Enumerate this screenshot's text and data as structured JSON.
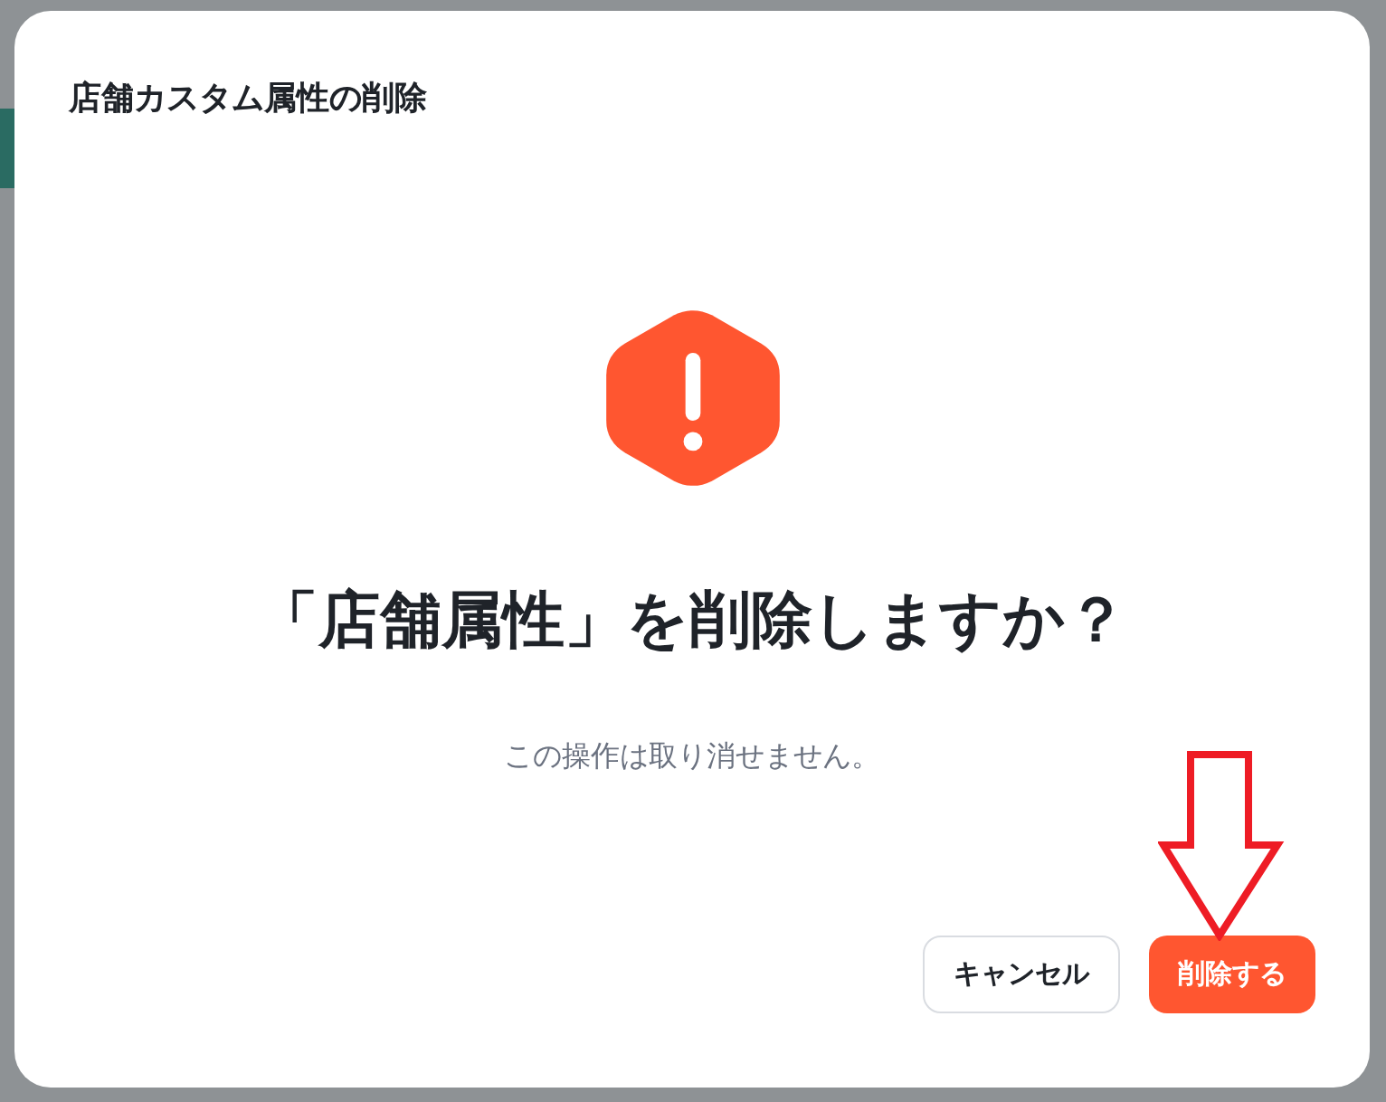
{
  "dialog": {
    "title": "店舗カスタム属性の削除",
    "heading": "「店舗属性」を削除しますか？",
    "message": "この操作は取り消せません。",
    "buttons": [
      {
        "label": "キャンセル",
        "kind": "secondary"
      },
      {
        "label": "削除する",
        "kind": "danger"
      }
    ]
  }
}
